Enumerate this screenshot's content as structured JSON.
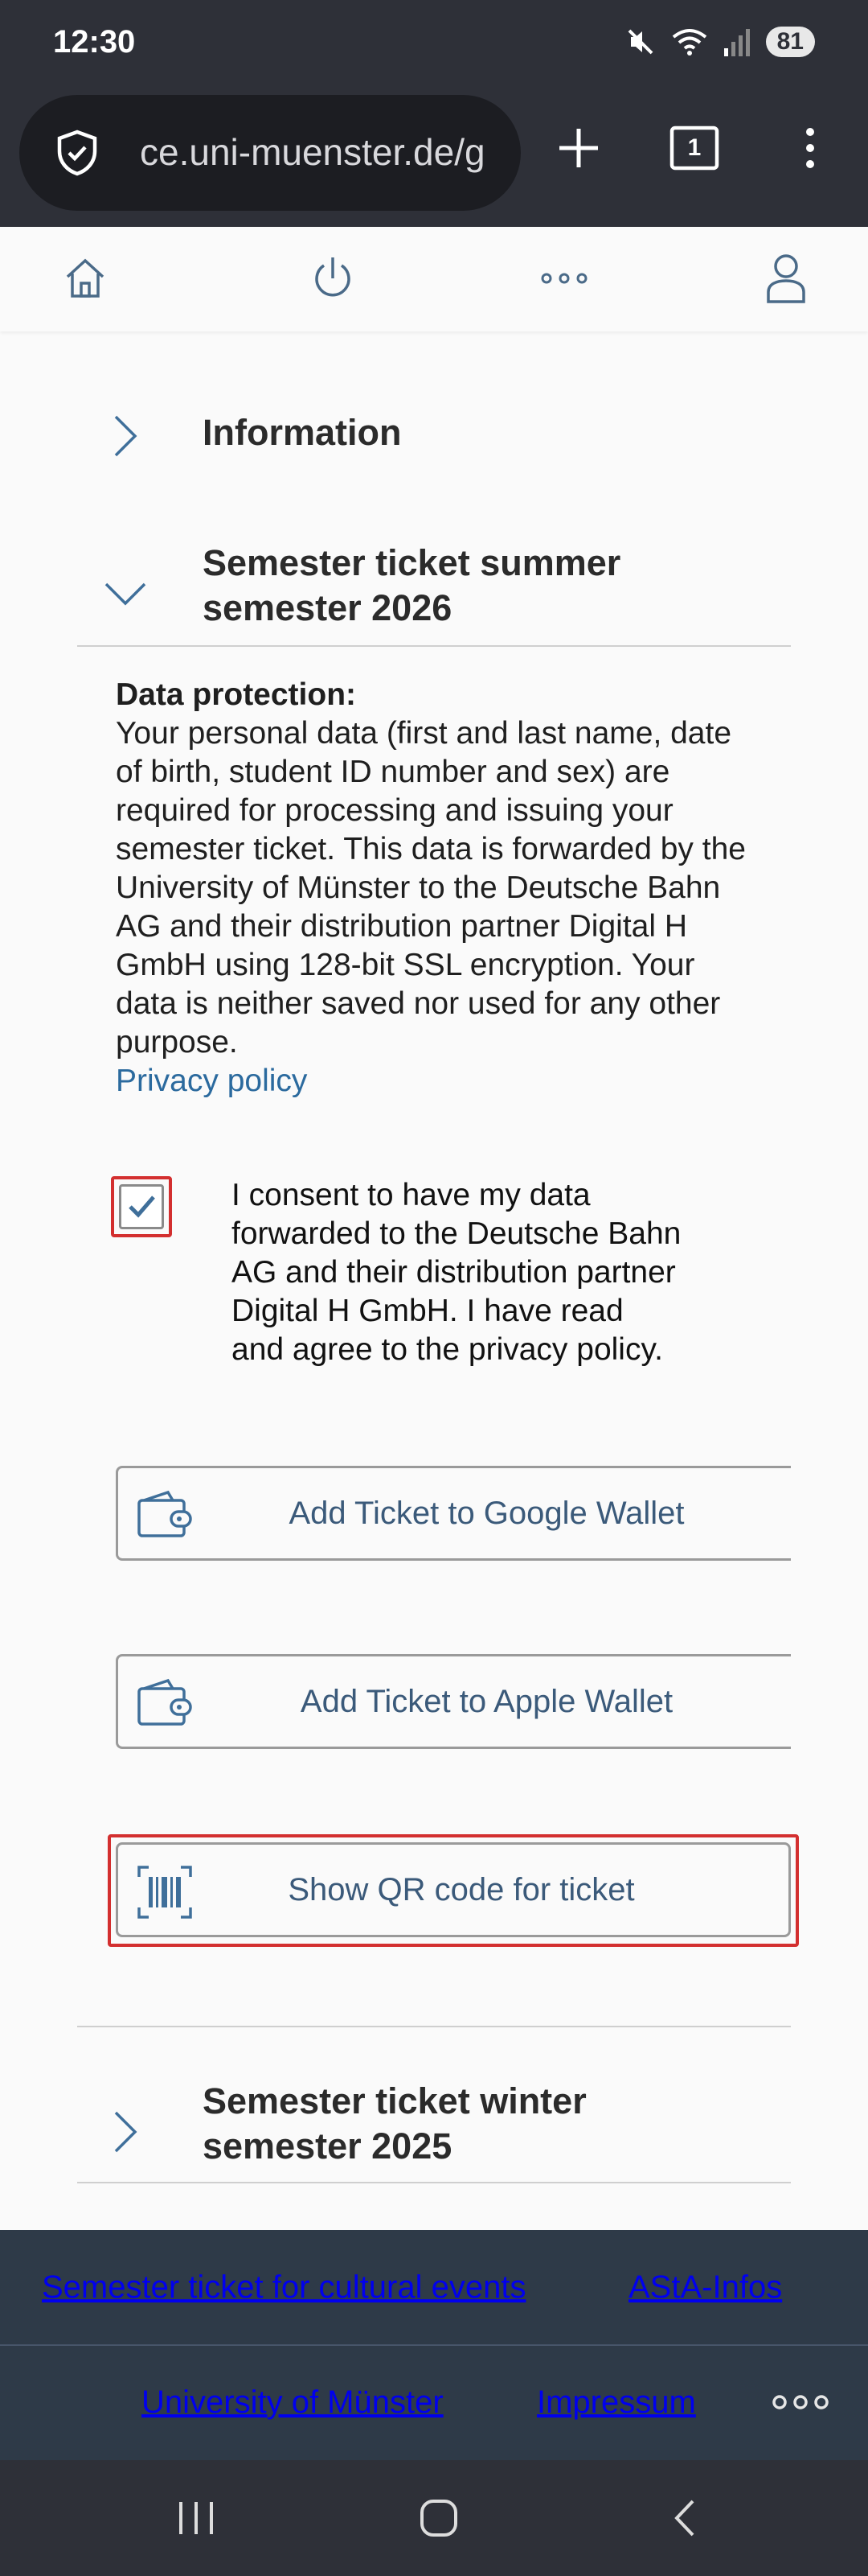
{
  "status": {
    "time": "12:30",
    "battery": "81"
  },
  "browser": {
    "url": "ce.uni-muenster.de/g",
    "tab_count": "1"
  },
  "accordion": {
    "information": "Information",
    "summer": "Semester ticket summer semester 2026",
    "winter": "Semester ticket winter semester 2025"
  },
  "data_protection": {
    "heading": "Data protection:",
    "body": "Your personal data (first and last name, date of birth, student ID number and sex) are required for processing and issuing your semester ticket. This data is forwarded by the University of Münster to the Deutsche Bahn AG and their distribution partner Digital H GmbH using 128-bit SSL encryption. Your data is neither saved nor used for any other purpose.",
    "privacy_link": "Privacy policy"
  },
  "consent": {
    "checked": true,
    "text": "I consent to have my data forwarded to the Deutsche Bahn AG and their distribution partner Digital H GmbH. I have read and agree to the privacy policy."
  },
  "buttons": {
    "google_wallet": "Add Ticket to Google Wallet",
    "apple_wallet": "Add Ticket to Apple Wallet",
    "qr_code": "Show QR code for ticket"
  },
  "footer": {
    "cultural": "Semester ticket for cultural events",
    "asta": "AStA-Infos",
    "university": "University of Münster",
    "impressum": "Impressum"
  },
  "colors": {
    "accent_link": "#2b6a9e",
    "highlight": "#d32f2f",
    "footer_bg": "#2e3a48"
  }
}
